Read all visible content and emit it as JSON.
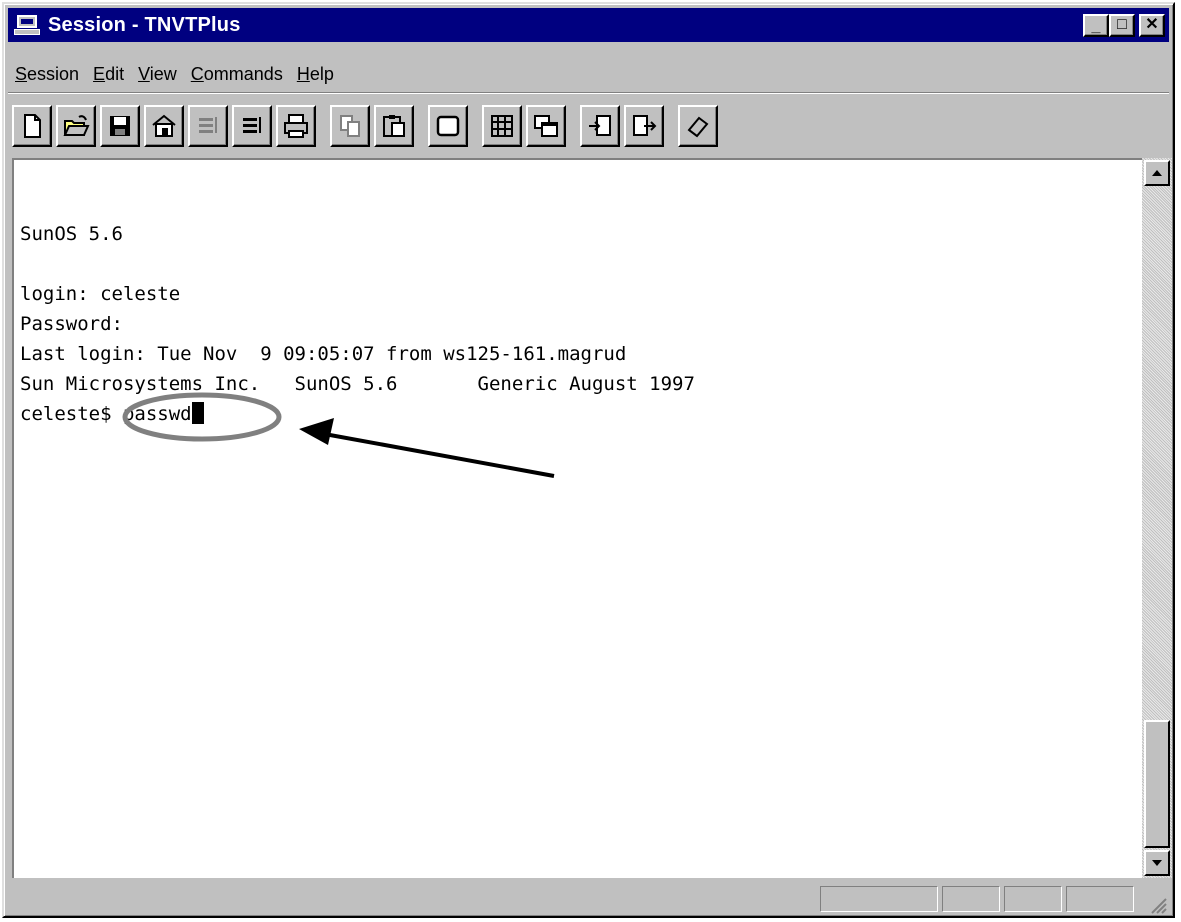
{
  "window": {
    "title": "Session - TNVTPlus",
    "minimize_glyph": "_",
    "maximize_glyph": "□",
    "close_glyph": "✕"
  },
  "menu": [
    {
      "accel": "S",
      "rest": "ession"
    },
    {
      "accel": "E",
      "rest": "dit"
    },
    {
      "accel": "V",
      "rest": "iew"
    },
    {
      "accel": "C",
      "rest": "ommands"
    },
    {
      "accel": "H",
      "rest": "elp"
    }
  ],
  "toolbar_icons": [
    "new-document-icon",
    "open-folder-icon",
    "save-disk-icon",
    "properties-icon",
    "receive-icon",
    "send-icon",
    "print-icon",
    "copy-icon",
    "paste-icon",
    "screen-icon",
    "grid-icon",
    "multi-window-icon",
    "import-icon",
    "export-icon",
    "eraser-icon"
  ],
  "terminal": {
    "lines": [
      "SunOS 5.6",
      "",
      "login: celeste",
      "Password:",
      "Last login: Tue Nov  9 09:05:07 from ws125-161.magrud",
      "Sun Microsystems Inc.   SunOS 5.6       Generic August 1997"
    ],
    "prompt": "celeste$ ",
    "command": "passwd"
  },
  "annotation": {
    "color": "#808080",
    "arrow_color": "#000000"
  },
  "colors": {
    "titlebar": "#000080",
    "chrome": "#c0c0c0"
  }
}
